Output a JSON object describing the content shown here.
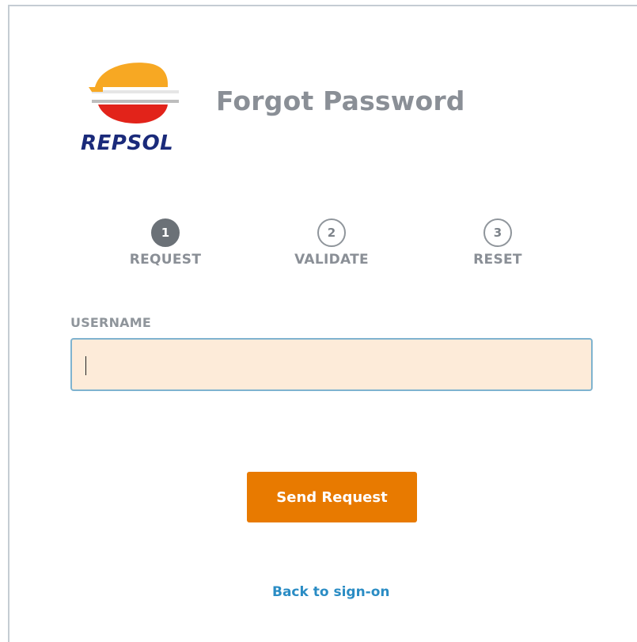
{
  "brand": {
    "logo_text": "REPSOL",
    "colors": {
      "orange": "#f7a823",
      "red": "#e2231a",
      "navy": "#1a2a7a"
    }
  },
  "header": {
    "title": "Forgot Password"
  },
  "steps": [
    {
      "number": "1",
      "label": "REQUEST",
      "active": true
    },
    {
      "number": "2",
      "label": "VALIDATE",
      "active": false
    },
    {
      "number": "3",
      "label": "RESET",
      "active": false
    }
  ],
  "form": {
    "username_label": "USERNAME",
    "username_value": "",
    "send_label": "Send Request",
    "back_link_label": "Back to sign-on"
  },
  "colors": {
    "button": "#e87a00",
    "link": "#2a8cc4",
    "input_bg": "#fdebd9",
    "input_border": "#7fb3cf",
    "step_active": "#6b7177"
  }
}
